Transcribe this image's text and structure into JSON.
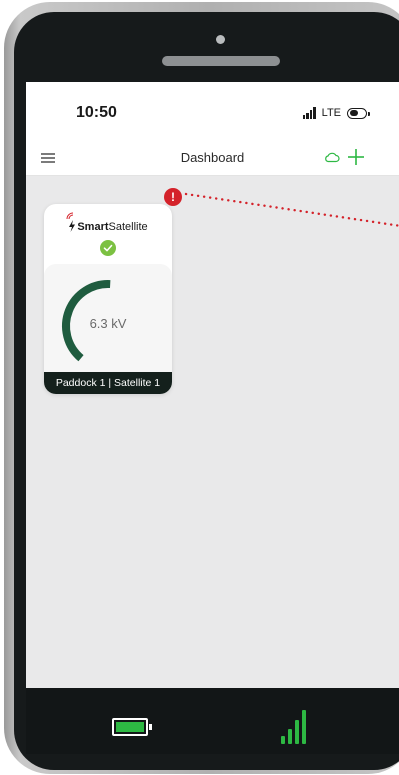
{
  "status_bar": {
    "time": "10:50",
    "network": "LTE"
  },
  "navbar": {
    "title": "Dashboard",
    "menu_icon": "hamburger-menu-icon",
    "cloud_icon": "cloud-icon",
    "add_icon": "plus-icon"
  },
  "device_card": {
    "brand_bold": "Smart",
    "brand_regular": "Satellite",
    "status_icon": "check-circle-icon",
    "gauge_value": "6.3 kV",
    "gauge_fraction": 0.55,
    "label": "Paddock 1 | Satellite 1",
    "alert_symbol": "!"
  },
  "bottom_bar": {
    "battery_icon": "battery-full-icon",
    "battery_level": 1.0,
    "signal_icon": "signal-strength-icon",
    "signal_level": 1.0
  },
  "colors": {
    "accent_green": "#2db843",
    "gauge_green": "#1f5c3f",
    "alert_red": "#d4222a",
    "dark": "#14201c"
  }
}
